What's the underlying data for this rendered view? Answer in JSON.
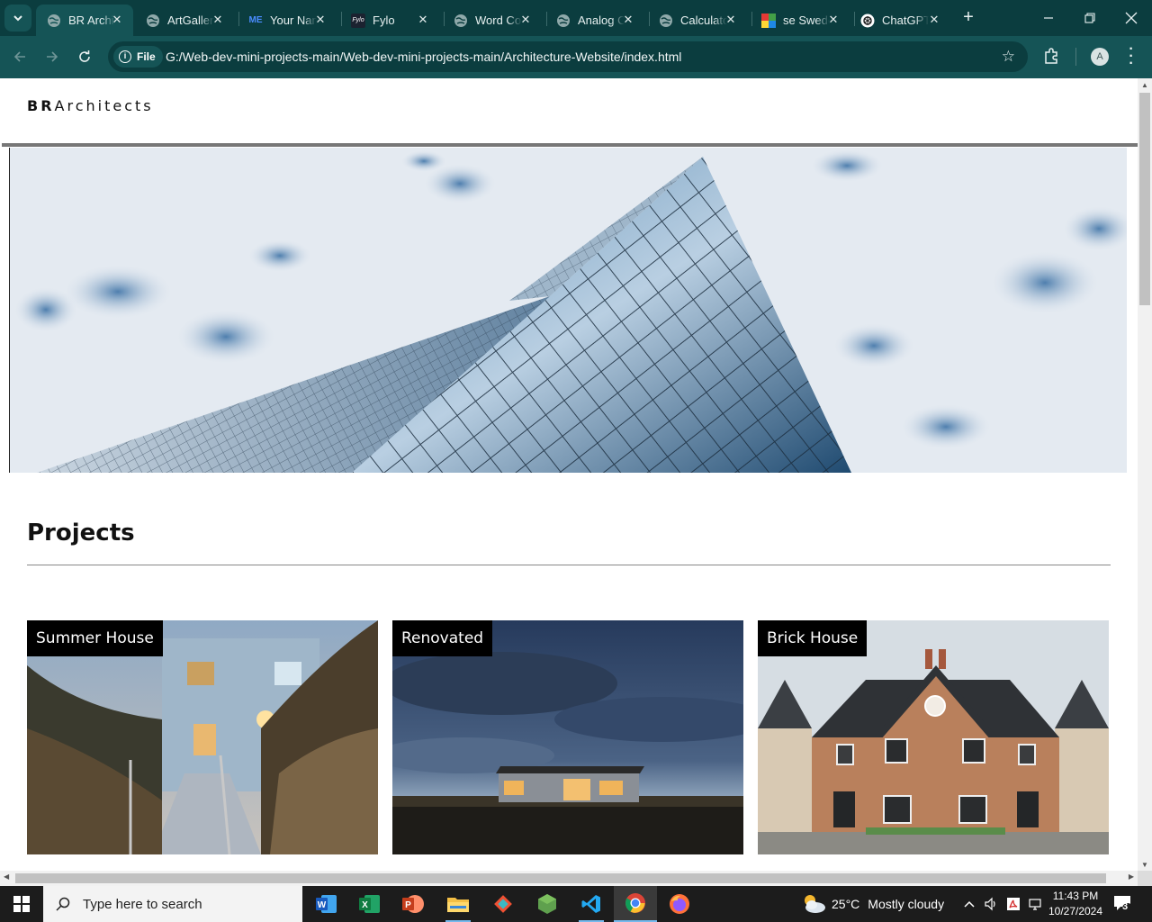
{
  "browser": {
    "tabs": [
      {
        "title": "BR Architects",
        "favicon": "globe-icon",
        "active": true
      },
      {
        "title": "ArtGallery",
        "favicon": "globe-icon",
        "active": false
      },
      {
        "title": "Your Name",
        "favicon": "me-logo-icon",
        "active": false
      },
      {
        "title": "Fylo",
        "favicon": "fylo-logo-icon",
        "active": false
      },
      {
        "title": "Word Counter",
        "favicon": "globe-icon",
        "active": false
      },
      {
        "title": "Analog Clock",
        "favicon": "globe-icon",
        "active": false
      },
      {
        "title": "Calculator",
        "favicon": "globe-icon",
        "active": false
      },
      {
        "title": "se Sweden",
        "favicon": "colorful-grid-icon",
        "active": false
      },
      {
        "title": "ChatGPT",
        "favicon": "chatgpt-icon",
        "active": false
      }
    ],
    "site_chip": "File",
    "url": "G:/Web-dev-mini-projects-main/Web-dev-mini-projects-main/Architecture-Website/index.html",
    "profile_initial": "A"
  },
  "site": {
    "brand_bold": "BR",
    "brand_rest": "Architects",
    "projects_heading": "Projects",
    "projects": [
      {
        "label": "Summer House"
      },
      {
        "label": "Renovated"
      },
      {
        "label": "Brick House"
      }
    ]
  },
  "taskbar": {
    "search_placeholder": "Type here to search",
    "weather_temp": "25°C",
    "weather_desc": "Mostly cloudy",
    "time": "11:43 PM",
    "date": "10/27/2024",
    "notification_count": "3",
    "apps": [
      "word-icon",
      "excel-icon",
      "powerpoint-icon",
      "file-explorer-icon",
      "git-icon",
      "nodejs-icon",
      "vscode-icon",
      "chrome-icon",
      "firefox-icon"
    ]
  },
  "colors": {
    "chrome_dark": "#0b3d3f",
    "chrome_toolbar": "#155456",
    "taskbar": "#1c1c1c"
  }
}
